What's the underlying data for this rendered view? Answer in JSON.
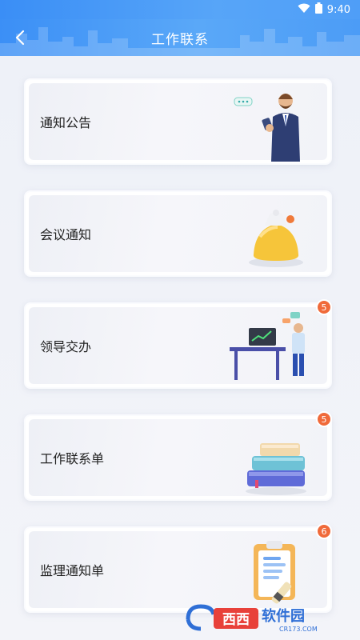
{
  "status_bar": {
    "time": "9:40"
  },
  "header": {
    "title": "工作联系"
  },
  "cards": [
    {
      "label": "通知公告",
      "badge": ""
    },
    {
      "label": "会议通知",
      "badge": ""
    },
    {
      "label": "领导交办",
      "badge": "5"
    },
    {
      "label": "工作联系单",
      "badge": "5"
    },
    {
      "label": "监理通知单",
      "badge": "6"
    }
  ],
  "watermark": {
    "text": "西西软件园",
    "sub": "CR173.COM"
  },
  "colors": {
    "header": "#4a9cf6",
    "badge": "#f06a3a",
    "bell": "#f6c53a"
  }
}
